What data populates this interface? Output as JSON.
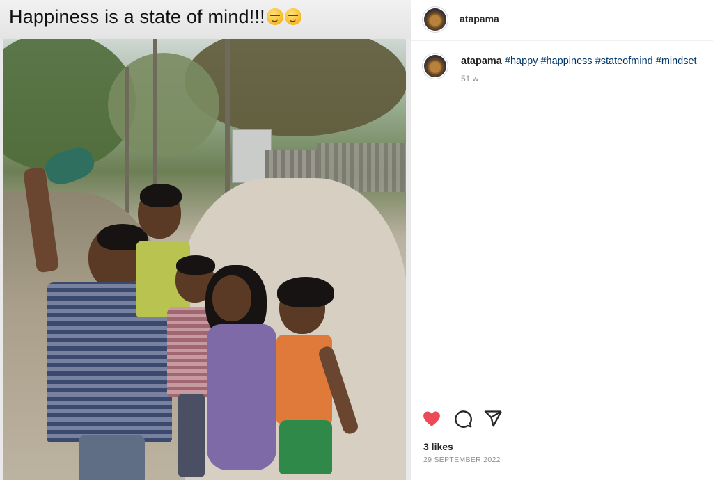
{
  "post": {
    "caption_overlay": "Happiness is a state of mind!!!",
    "caption_emojis": [
      "smirk-emoji",
      "smirk-emoji"
    ]
  },
  "sidebar": {
    "username": "atapama",
    "comment": {
      "username": "atapama",
      "hashtags": [
        "#happy",
        "#happiness",
        "#stateofmind",
        "#mindset"
      ],
      "time": "51 w"
    },
    "actions": {
      "like_icon": "heart-icon",
      "comment_icon": "comment-icon",
      "share_icon": "share-icon",
      "like_color": "#ed4956"
    },
    "likes": "3 likes",
    "date": "29 SEPTEMBER 2022"
  }
}
